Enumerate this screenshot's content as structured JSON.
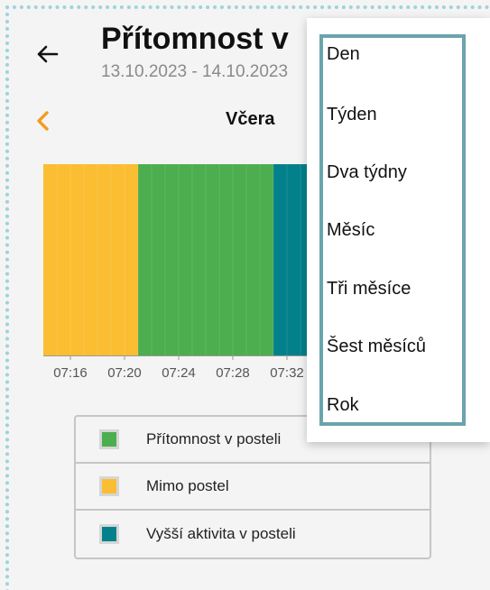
{
  "header": {
    "title": "Přítomnost v",
    "date_range": "13.10.2023 - 14.10.2023"
  },
  "period_nav": {
    "label": "Včera"
  },
  "chart_data": {
    "type": "bar",
    "subtype": "timeline",
    "x_ticks": [
      "07:16",
      "07:20",
      "07:24",
      "07:28",
      "07:32"
    ],
    "x_range": [
      "07:14",
      "07:34"
    ],
    "segments": [
      {
        "state": "Mimo postel",
        "start": "07:14",
        "end": "07:21",
        "color": "#fbbd32"
      },
      {
        "state": "Přítomnost v posteli",
        "start": "07:21",
        "end": "07:31",
        "color": "#4cae4f"
      },
      {
        "state": "Vyšší aktivita v posteli",
        "start": "07:31",
        "end": "07:34",
        "color": "#02818d"
      }
    ],
    "legend": [
      {
        "label": "Přítomnost v posteli",
        "color": "#4cae4f"
      },
      {
        "label": "Mimo postel",
        "color": "#fbbd32"
      },
      {
        "label": "Vyšší aktivita v posteli",
        "color": "#02818d"
      }
    ],
    "legend_position": "bottom"
  },
  "dropdown": {
    "items": [
      "Den",
      "Týden",
      "Dva týdny",
      "Měsíc",
      "Tři měsíce",
      "Šest měsíců",
      "Rok"
    ]
  },
  "colors": {
    "accent": "#f29c1f",
    "menu_border": "#6aa4ad"
  },
  "icons": {
    "back": "arrow-left-icon",
    "prev": "chevron-left-icon"
  }
}
